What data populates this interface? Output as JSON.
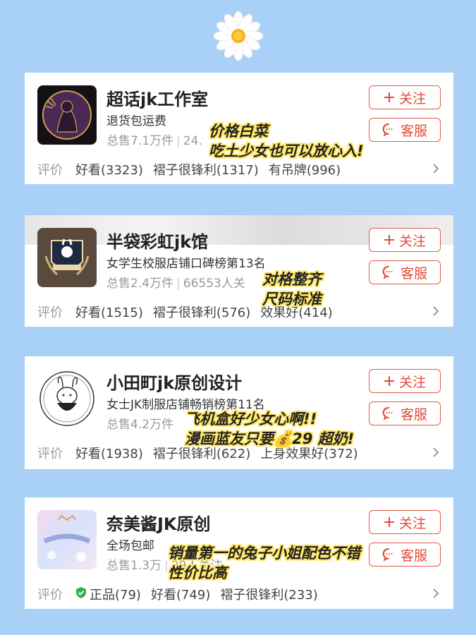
{
  "decoration": {
    "flower": "daisy-icon"
  },
  "buttons": {
    "follow": "关注",
    "service": "客服"
  },
  "shops": [
    {
      "name": "超话jk工作室",
      "subtitle": "退货包运费",
      "sales": "总售7.1万件",
      "followers": "24.",
      "rating_label": "评价",
      "tags": [
        "好看(3323)",
        "褶子很锋利(1317)",
        "有吊牌(996)"
      ],
      "overlay": [
        "价格白菜",
        "吃土少女也可以放心入!"
      ]
    },
    {
      "name": "半袋彩虹jk馆",
      "subtitle": "女学生校服店铺口碑榜第13名",
      "sales": "总售2.4万件",
      "followers": "66553人关",
      "rating_label": "评价",
      "tags": [
        "好看(1515)",
        "褶子很锋利(576)",
        "效果好(414)"
      ],
      "overlay": [
        "对格整齐",
        "尺码标准"
      ]
    },
    {
      "name": "小田町jk原创设计",
      "subtitle": "女士JK制服店铺畅销榜第11名",
      "sales": "总售4.2万件",
      "followers": "",
      "rating_label": "评价",
      "tags": [
        "好看(1938)",
        "褶子很锋利(622)",
        "上身效果好(372)"
      ],
      "overlay": [
        "飞机盒好少女心啊!!",
        "漫画蓝友只要💰29 超奶!"
      ]
    },
    {
      "name": "奈美酱JK原创",
      "subtitle": "全场包邮",
      "sales": "总售1.3万",
      "followers": "29人关注",
      "rating_label": "评价",
      "tags": [
        "正品(79)",
        "好看(749)",
        "褶子很锋利(233)"
      ],
      "overlay": [
        "销量第一的兔子小姐配色不错",
        "性价比高"
      ]
    }
  ]
}
